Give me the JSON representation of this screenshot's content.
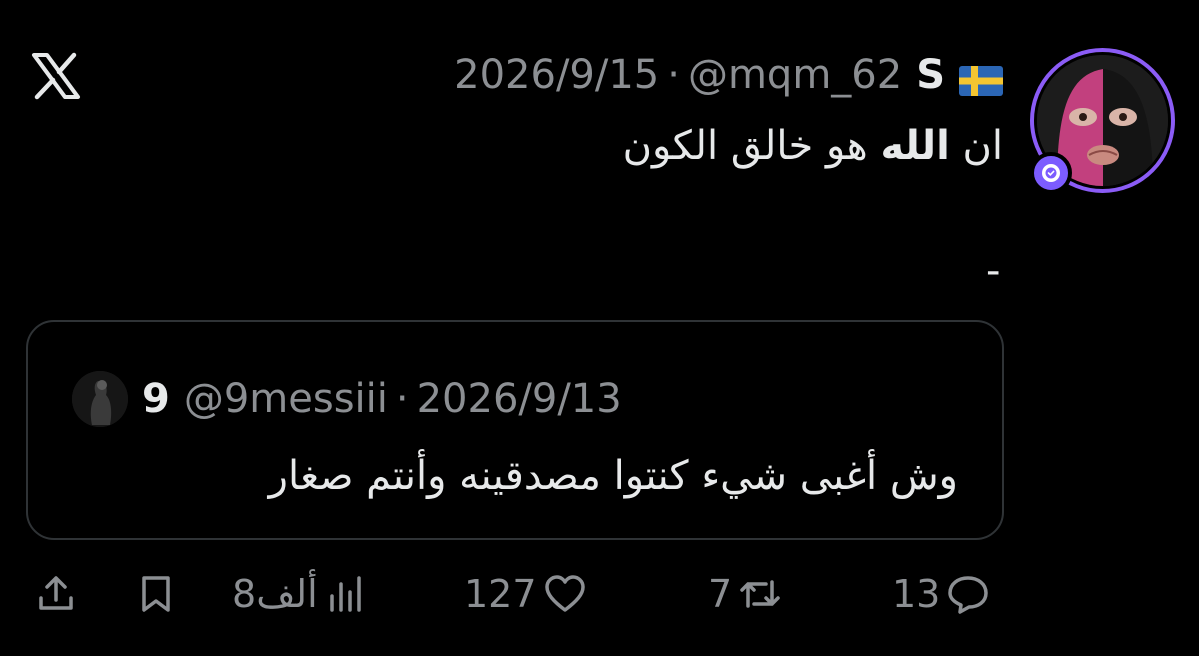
{
  "logo": {
    "icon": "x-logo-icon"
  },
  "tweet": {
    "author_name": "S",
    "author_flag": "sweden-flag-icon",
    "handle": "@mqm_62",
    "separator": "·",
    "date": "2026/9/15",
    "text_before": "ان ",
    "text_bold": "الله",
    "text_after": " هو خالق الكون",
    "dash": "-"
  },
  "quoted": {
    "name": "9",
    "handle": "@9messiii",
    "separator": "·",
    "date": "2026/9/13",
    "text": "وش أغبى شيء كنتوا مصدقينه وأنتم صغار"
  },
  "actions": {
    "replies": "13",
    "reposts": "7",
    "likes": "127",
    "views": "8ألف"
  },
  "colors": {
    "background": "#000000",
    "text": "#e7e9ea",
    "muted": "#8c8f93",
    "border": "#2f3336",
    "avatar_ring": "#8b5cf6"
  }
}
